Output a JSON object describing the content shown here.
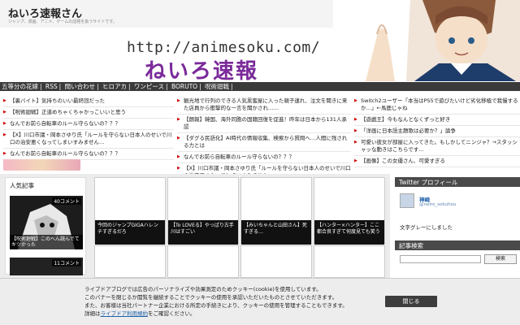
{
  "site": {
    "title": "ねいろ速報さん",
    "tagline": "ジャンプ、漫画、アニメ、ゲームの話題を扱うサイトです。",
    "url": "http://animesoku.com/",
    "logo": "ねいろ速報"
  },
  "nav": [
    "五等分の花嫁",
    "RSS",
    "問い合わせ",
    "ヒロアカ",
    "ワンピース",
    "BORUTO",
    "呪術廻戦"
  ],
  "links": {
    "col1": [
      "【裏バイト】気持ちのいい最終回だった",
      "【呪術廻戦】正道めちゃくちゃかっこいいと思う",
      "なんでお前ら自転車のルール守らないの？？？",
      "【X】川口市議・岡本さゆり氏「ルールを守らない日本人のせいで川口の治安悪くなってしまいすみません…",
      "なんでお前ら自転車のルール守らないの？？？"
    ],
    "col2": [
      "観光地で行列のできる人気黒蜜屋に入った親子連れ、注文を聞きに来た店員から衝撃的な一言を聞かされ……",
      "【朗報】韓国、海外同胞の国籍回復を促進！昨年は日本から131人承認",
      "【ダグる民語化】AI時代の情報収集、検索から質問へ…人間に残される力とは",
      "なんでお前ら自転車のルール守らないの？？？",
      "【X】川口市議・岡本さゆり氏「ルールを守らない日本人のせいで川口の治安悪くなってしまいすみません…"
    ],
    "col3": [
      "Switch2ユーザー「本当はPS5で遊びたいけど劣化移植で我慢するか…」←馬鹿じゃね",
      "【遊戯王】今もなんとなくずっと好き",
      "「洋画に日本語主題歌は必要か？」論争",
      "可愛い彼女が部屋に入ってきた。もしかしてニンジャ？→スタッシャッな動きはこちらです…",
      "【画像】この女優さん、可愛すぎる"
    ]
  },
  "popular": {
    "title": "人気記事",
    "item1": {
      "comments": "40コメント",
      "caption": "【呪術廻戦】このへん読んでてキツかった"
    },
    "item2": {
      "comments": "11コメント"
    }
  },
  "tiles": [
    {
      "caption": "今回のジャンプGIGAハレンチすぎるだろ"
    },
    {
      "caption": "【To LOVEる】やっぱり古手川はすごい"
    },
    {
      "caption": "【みいちゃんと山田さん】死すぎる…"
    },
    {
      "caption": "【ハンター×ハンター】ここ都合良すぎて何度見ても笑う"
    }
  ],
  "sidebar": {
    "twitter_title": "Twitter プロフィール",
    "twitter_name": "神崎",
    "twitter_handle": "@neiro_sokuhou",
    "twitter_desc": "文字グレーにしました",
    "search_title": "記事検索",
    "search_button": "検索",
    "search_placeholder": ""
  },
  "cookie": {
    "line1": "ライブドアブログでは広告のパーソナライズや効果測定のためクッキー(cookie)を使用しています。",
    "line2": "このバナーを閉じるか閲覧を継続することでクッキーの使用を承認いただいたものとさせていただきます。",
    "line3": "また、お客様は当社パートナー企業における所定の手続きにより、クッキーの使用を管理することもできます。",
    "line4_prefix": "詳細は",
    "line4_link": "ライブドア利用規約",
    "line4_suffix": "をご確認ください。",
    "close": "閉じる"
  }
}
